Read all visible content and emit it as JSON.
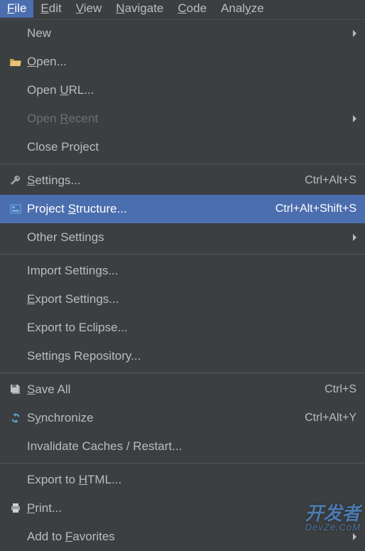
{
  "menubar": {
    "items": [
      {
        "label": "File",
        "mnemonic_index": 0,
        "active": true
      },
      {
        "label": "Edit",
        "mnemonic_index": 0
      },
      {
        "label": "View",
        "mnemonic_index": 0
      },
      {
        "label": "Navigate",
        "mnemonic_index": 0
      },
      {
        "label": "Code",
        "mnemonic_index": 0
      },
      {
        "label": "Analyze",
        "mnemonic_index": 4
      }
    ]
  },
  "file_menu": {
    "items": [
      {
        "label": "New",
        "submenu": true
      },
      {
        "label": "Open...",
        "mnemonic_index": 0,
        "icon": "folder-open-icon"
      },
      {
        "label": "Open URL...",
        "mnemonic_index": 5
      },
      {
        "label": "Open Recent",
        "mnemonic_index": 5,
        "submenu": true,
        "disabled": true
      },
      {
        "label": "Close Project"
      },
      {
        "separator": true
      },
      {
        "label": "Settings...",
        "mnemonic_index": 0,
        "icon": "settings-wrench-icon",
        "shortcut": "Ctrl+Alt+S"
      },
      {
        "label": "Project Structure...",
        "mnemonic_index": 8,
        "icon": "project-structure-icon",
        "shortcut": "Ctrl+Alt+Shift+S",
        "selected": true
      },
      {
        "label": "Other Settings",
        "submenu": true
      },
      {
        "separator": true
      },
      {
        "label": "Import Settings..."
      },
      {
        "label": "Export Settings...",
        "mnemonic_index": 0
      },
      {
        "label": "Export to Eclipse..."
      },
      {
        "label": "Settings Repository..."
      },
      {
        "separator": true
      },
      {
        "label": "Save All",
        "mnemonic_index": 0,
        "icon": "save-all-icon",
        "shortcut": "Ctrl+S"
      },
      {
        "label": "Synchronize",
        "mnemonic_index": 1,
        "icon": "sync-icon",
        "shortcut": "Ctrl+Alt+Y"
      },
      {
        "label": "Invalidate Caches / Restart..."
      },
      {
        "separator": true
      },
      {
        "label": "Export to HTML...",
        "mnemonic_index": 10
      },
      {
        "label": "Print...",
        "mnemonic_index": 0,
        "icon": "print-icon"
      },
      {
        "label": "Add to Favorites",
        "mnemonic_index": 7,
        "submenu": true
      }
    ]
  },
  "watermark": {
    "main": "开发者",
    "sub": "DevZe.CoM"
  }
}
